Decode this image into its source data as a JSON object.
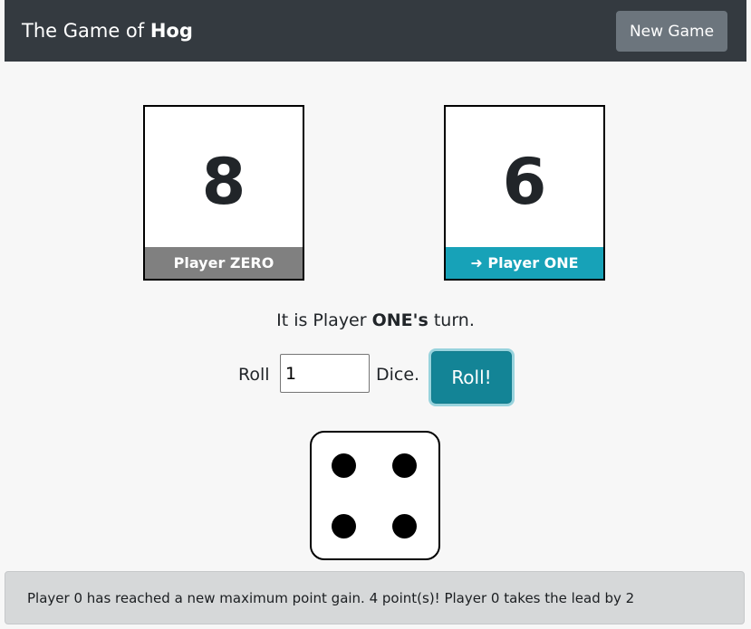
{
  "navbar": {
    "brand_prefix": "The Game of ",
    "brand_name": "Hog",
    "new_game_label": "New Game"
  },
  "players": [
    {
      "score": "8",
      "label": "Player ZERO",
      "label_color": "#808080"
    },
    {
      "score": "6",
      "label": "➜ Player ONE",
      "label_color": "#17a2b8"
    }
  ],
  "turn": {
    "prefix": "It is Player ",
    "player": "ONE's",
    "suffix": " turn."
  },
  "roll": {
    "prefix": "Roll",
    "dice_count": "1",
    "suffix": "Dice.",
    "button_label": "Roll!"
  },
  "die": {
    "face_value": 4
  },
  "message": {
    "text": "Player 0 has reached a new maximum point gain. 4 point(s)! Player 0 takes the lead by 2"
  },
  "colors": {
    "navbar_bg": "#343a40",
    "active_accent": "#17a2b8",
    "inactive_label": "#808080",
    "roll_button": "#138496"
  }
}
